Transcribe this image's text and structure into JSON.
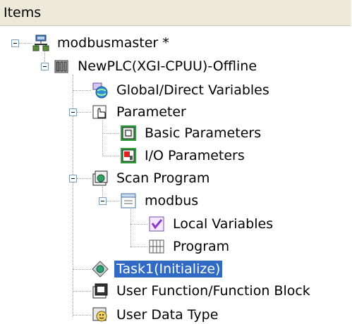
{
  "header": {
    "title": "Items"
  },
  "tree": {
    "project": "modbusmaster *",
    "plc": "NewPLC(XGI-CPUU)-Offline",
    "global_vars": "Global/Direct Variables",
    "parameter": "Parameter",
    "basic_params": "Basic Parameters",
    "io_params": "I/O Parameters",
    "scan_program": "Scan Program",
    "modbus": "modbus",
    "local_vars": "Local Variables",
    "program": "Program",
    "task1": "Task1(Initialize)",
    "user_function": "User Function/Function Block",
    "user_data_type": "User Data Type"
  },
  "colors": {
    "selection": "#316ac5",
    "header_bg": "#ece9d8"
  }
}
